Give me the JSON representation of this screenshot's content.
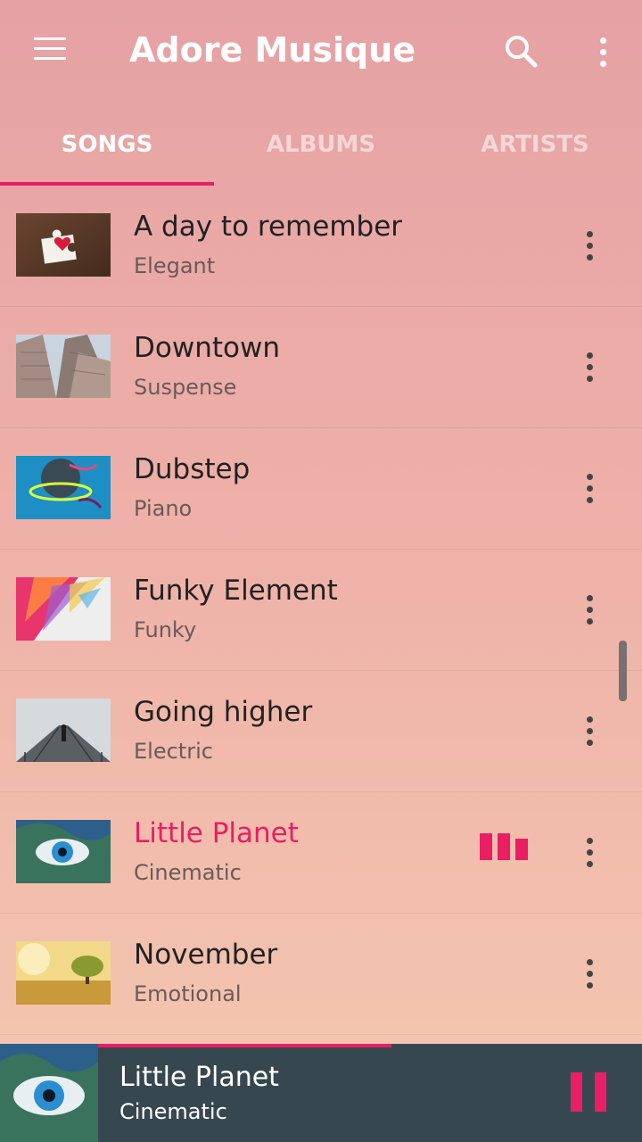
{
  "app": {
    "title": "Adore Musique"
  },
  "toolbar": {
    "menu_icon": "hamburger-menu-icon",
    "search_icon": "search-icon",
    "overflow_icon": "more-vert-icon"
  },
  "tabs": [
    {
      "label": "SONGS",
      "active": true
    },
    {
      "label": "ALBUMS",
      "active": false
    },
    {
      "label": "ARTISTS",
      "active": false
    }
  ],
  "songs": [
    {
      "title": "A day to remember",
      "genre": "Elegant",
      "playing": false
    },
    {
      "title": "Downtown",
      "genre": "Suspense",
      "playing": false
    },
    {
      "title": "Dubstep",
      "genre": "Piano",
      "playing": false
    },
    {
      "title": "Funky Element",
      "genre": "Funky",
      "playing": false
    },
    {
      "title": "Going higher",
      "genre": "Electric",
      "playing": false
    },
    {
      "title": "Little Planet",
      "genre": "Cinematic",
      "playing": true
    },
    {
      "title": "November",
      "genre": "Emotional",
      "playing": false
    }
  ],
  "now_playing": {
    "title": "Little Planet",
    "genre": "Cinematic",
    "progress": 0.54,
    "control_icon": "pause-icon"
  },
  "colors": {
    "accent": "#e91e63",
    "player_bg": "#37474f",
    "header_start": "#e5a1a4",
    "list_end": "#f4c8b0"
  }
}
